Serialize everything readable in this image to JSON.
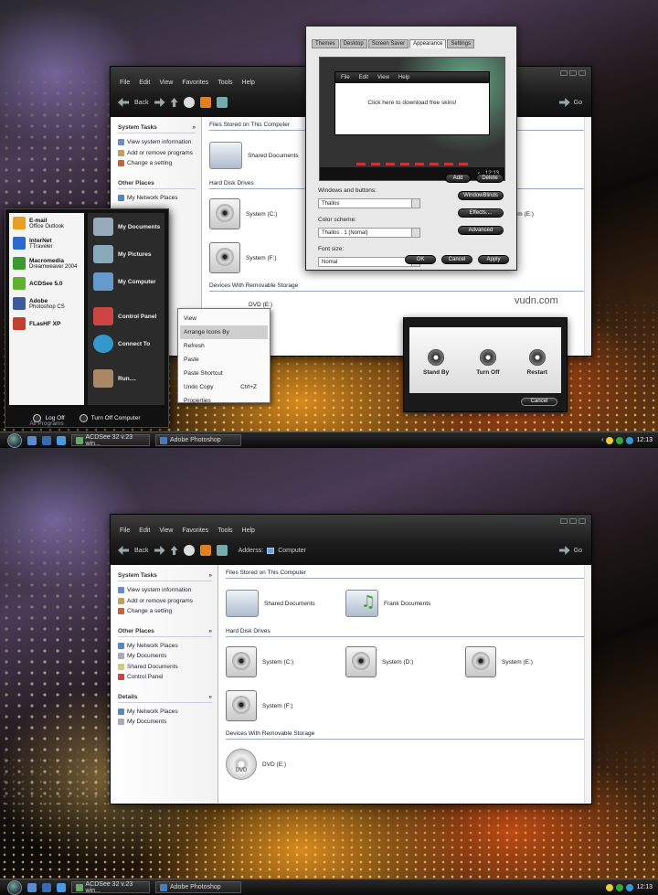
{
  "watermark": "vudn.com",
  "explorer": {
    "menu": [
      "File",
      "Edit",
      "View",
      "Favorites",
      "Tools",
      "Help"
    ],
    "back": "Back",
    "go": "Go",
    "address_label": "Adderss:",
    "address_value": "Computer",
    "system_tasks": {
      "title": "System Tasks",
      "items": [
        "View system information",
        "Add or remove programs",
        "Change a setting"
      ]
    },
    "other_places": {
      "title": "Other Places",
      "items": [
        "My Network Places",
        "My Documents",
        "Shared Documents",
        "Control Panel"
      ]
    },
    "details": {
      "title": "Details",
      "items": [
        "My Network Places",
        "My Documents"
      ]
    },
    "sections": {
      "files": "Files Stored on This Computer",
      "hdd": "Hard Disk Drives",
      "removable": "Devices With Removable Storage"
    },
    "files": [
      "Shared Documents",
      "Frank Documents"
    ],
    "drives": [
      "System (C:)",
      "System (D:)",
      "System (E:)",
      "System (F:)"
    ],
    "dvd": "DVD (E:)",
    "dvd_disc": "DVD"
  },
  "props": {
    "tabs": [
      "Themes",
      "Desktop",
      "Screen Saver",
      "Appearance",
      "Settings"
    ],
    "preview_menu": [
      "File",
      "Edit",
      "View",
      "Help"
    ],
    "preview_text": "Click here to download free skins!",
    "preview_clock": "12:13",
    "wb_label": "Windows and buttons:",
    "wb_value": "Thallos",
    "cs_label": "Color scheme:",
    "cs_value": "Thallos . 1 (Nomal)",
    "fs_label": "Font size:",
    "fs_value": "Nomal",
    "btn_add": "Add",
    "btn_delete": "Delete",
    "btn_windowblinds": "WindowBlinds",
    "btn_effects": "Effects....",
    "btn_advanced": "Advanced",
    "ok": "OK",
    "cancel": "Cancel",
    "apply": "Apply"
  },
  "startmenu": {
    "programs": [
      {
        "title": "E-mail",
        "sub": "Office Outlook",
        "color": "#e8a020"
      },
      {
        "title": "InterNet",
        "sub": "TTraveler",
        "color": "#2a6ad0"
      },
      {
        "title": "Macromedia",
        "sub": "Dreamweaver  2004",
        "color": "#3a9a30"
      },
      {
        "title": "ACDSee 5.0",
        "sub": "",
        "color": "#60b030"
      },
      {
        "title": "Adobe",
        "sub": "Photoshop CS",
        "color": "#3a5a9a"
      },
      {
        "title": "FLasHF XP",
        "sub": "",
        "color": "#c04030"
      }
    ],
    "all_programs": "All Programs",
    "places": [
      "My Documents",
      "My Pictures",
      "My Computer",
      "Control Panel",
      "Connect To",
      "Run...."
    ],
    "logoff": "Log Off",
    "turnoff": "Turn Off Computer"
  },
  "context": {
    "items": [
      "View",
      "Arrange Icons By",
      "Refresh",
      "Paste",
      "Paste Shortcut",
      "Undo Copy",
      "Properties"
    ],
    "shortcut": "Ctrl+Z"
  },
  "shutdown": {
    "standby": "Stand By",
    "turnoff": "Turn Off",
    "restart": "Restart",
    "cancel": "Cancel"
  },
  "taskbar": {
    "tasks": [
      "ACDSee 32 v.23 win...",
      "Adobe  Photoshop"
    ],
    "clock": "12:13"
  }
}
